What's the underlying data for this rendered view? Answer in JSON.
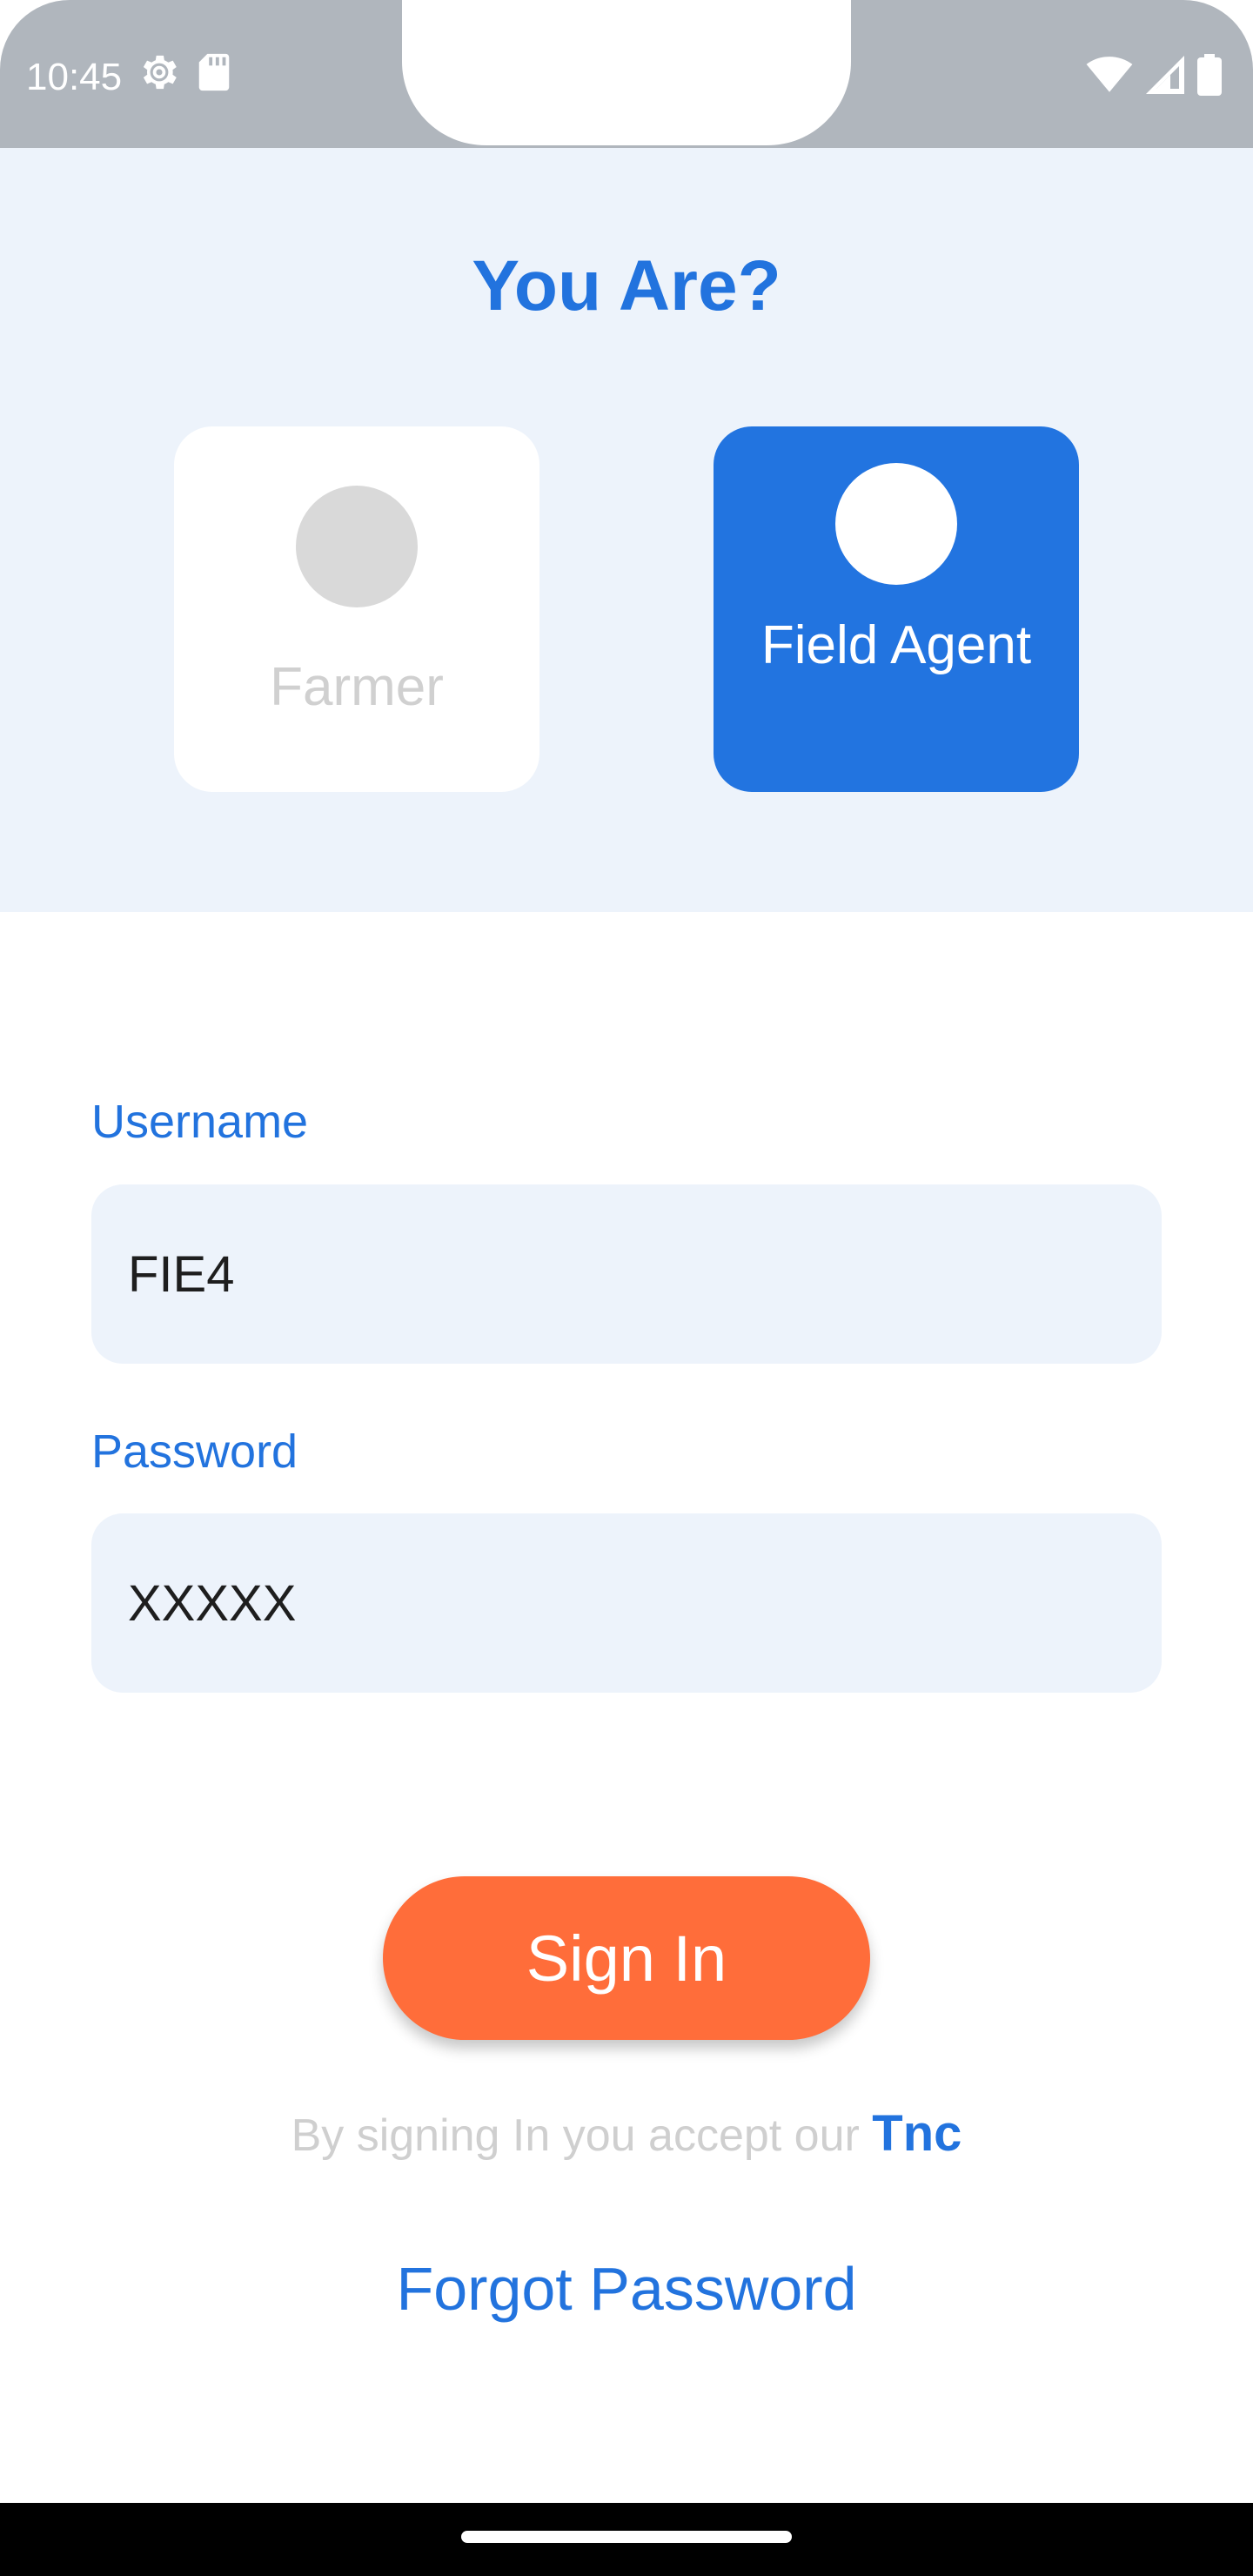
{
  "status_bar": {
    "time": "10:45",
    "icons": [
      "settings-gear-icon",
      "sd-card-icon",
      "wifi-icon",
      "cell-signal-icon",
      "battery-icon"
    ]
  },
  "role_selector": {
    "title": "You Are?",
    "options": [
      {
        "label": "Farmer",
        "selected": false
      },
      {
        "label": "Field Agent",
        "selected": true
      }
    ]
  },
  "form": {
    "username_label": "Username",
    "username_value": "FIE4",
    "password_label": "Password",
    "password_value": "XXXXX"
  },
  "actions": {
    "sign_in_label": "Sign In",
    "terms_text": "By signing In you accept our ",
    "terms_link": "Tnc",
    "forgot_password": "Forgot Password"
  },
  "colors": {
    "primary_blue": "#2274e0",
    "accent_orange": "#ff6d3a",
    "light_bg": "#edf3fb",
    "status_bar_gray": "#b0b6bd"
  }
}
